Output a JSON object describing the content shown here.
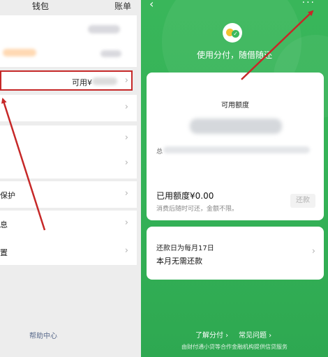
{
  "left": {
    "header": {
      "title": "钱包",
      "bill": "账单"
    },
    "available": {
      "prefix": "可用¥"
    },
    "rows": [
      {
        "label": ""
      },
      {
        "label": ""
      },
      {
        "label": ""
      },
      {
        "label": "保护"
      },
      {
        "label": "息"
      },
      {
        "label": "置"
      }
    ],
    "help": "帮助中心"
  },
  "right": {
    "back_icon": "‹",
    "more_icon": "···",
    "slogan": "使用分付，随借随还",
    "credit_title": "可用额度",
    "total_label": "总",
    "used": "已用额度¥0.00",
    "used_sub": "消费后随时可还，金额不限。",
    "repay_button": "还款",
    "due_day": "还款日为每月17日",
    "due_status": "本月无需还款",
    "links": [
      "了解分付 ›",
      "常见问题 ›"
    ],
    "footer": "由财付通小贷等合作金融机构提供信贷服务"
  },
  "colors": {
    "green": "#36b358",
    "annotation_red": "#c62828"
  }
}
